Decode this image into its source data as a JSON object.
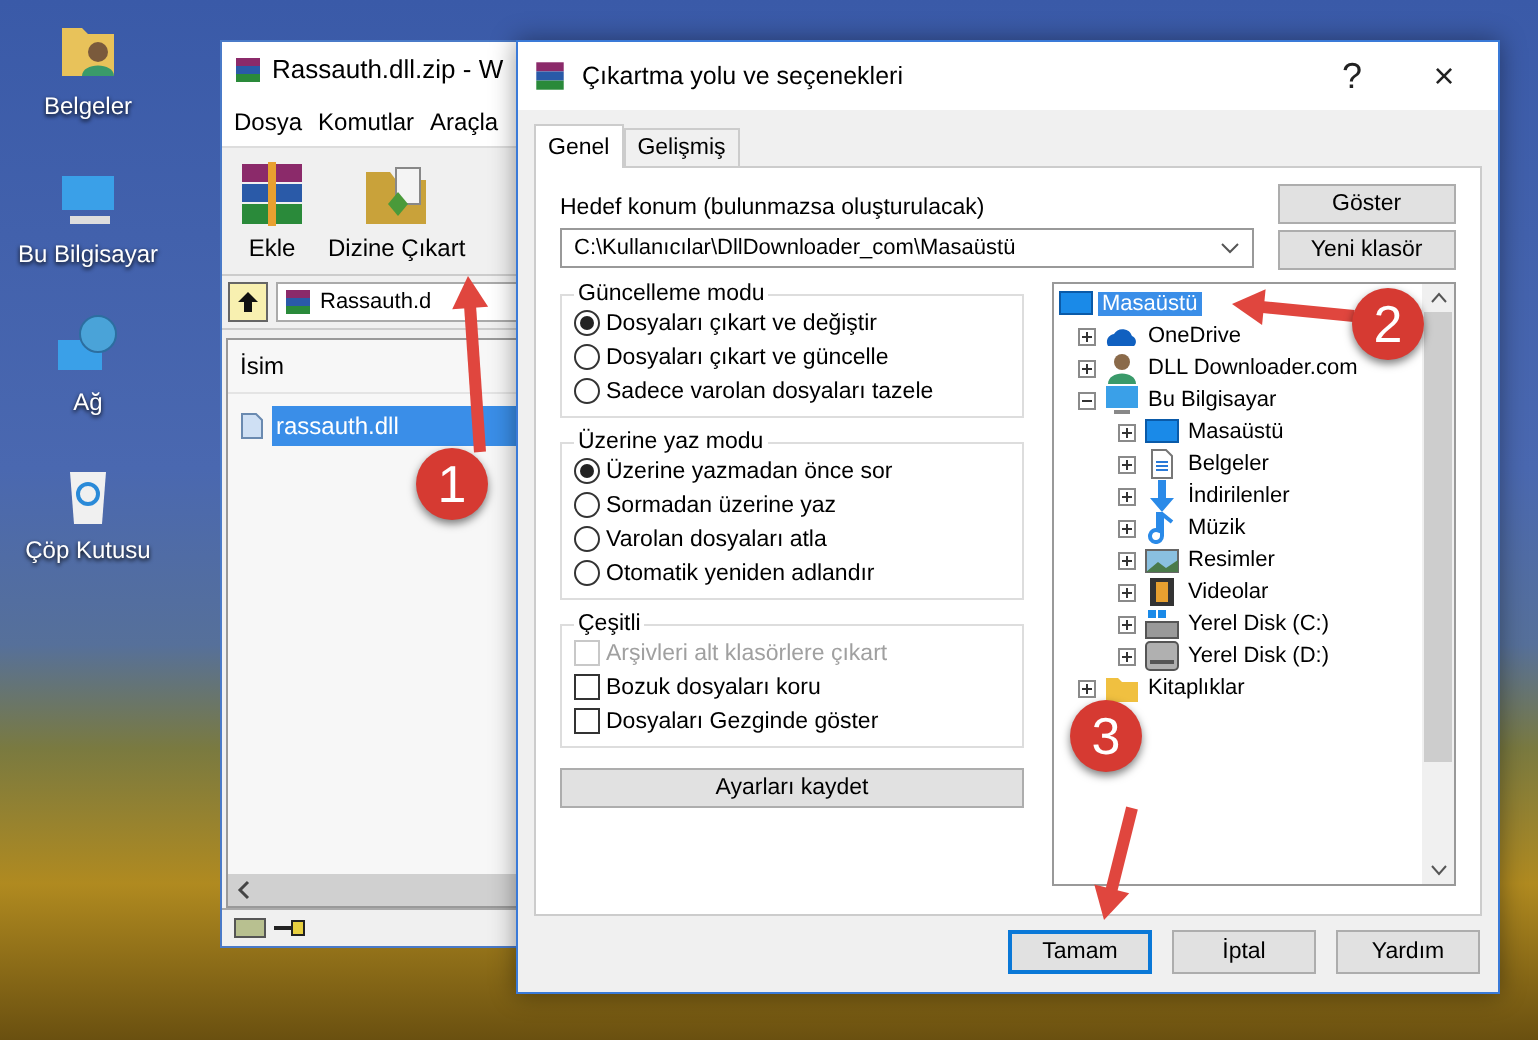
{
  "desktop_icons": [
    {
      "label": "Belgeler"
    },
    {
      "label": "Bu Bilgisayar"
    },
    {
      "label": "Ağ"
    },
    {
      "label": "Çöp Kutusu"
    }
  ],
  "archive_window": {
    "title": "Rassauth.dll.zip - W",
    "menu": [
      "Dosya",
      "Komutlar",
      "Araçla"
    ],
    "toolbar": [
      "Ekle",
      "Dizine Çıkart"
    ],
    "address": "Rassauth.d",
    "column": "İsim",
    "files": [
      {
        "name": "rassauth.dll",
        "selected": true
      }
    ]
  },
  "dialog": {
    "title": "Çıkartma yolu ve seçenekleri",
    "title_buttons": [
      "?",
      "×"
    ],
    "tabs": [
      {
        "label": "Genel",
        "selected": true
      },
      {
        "label": "Gelişmiş",
        "selected": false
      }
    ],
    "destination_label": "Hedef konum (bulunmazsa oluşturulacak)",
    "destination": "C:\\Kullanıcılar\\DllDownloader_com\\Masaüstü",
    "side_buttons": [
      "Göster",
      "Yeni klasör"
    ],
    "groups": [
      {
        "title": "Güncelleme modu",
        "kind": "radio",
        "options": [
          {
            "label": "Dosyaları çıkart ve değiştir",
            "selected": true,
            "disabled": false
          },
          {
            "label": "Dosyaları çıkart ve güncelle",
            "selected": false,
            "disabled": false
          },
          {
            "label": "Sadece varolan dosyaları tazele",
            "selected": false,
            "disabled": false
          }
        ]
      },
      {
        "title": "Üzerine yaz modu",
        "kind": "radio",
        "options": [
          {
            "label": "Üzerine yazmadan önce sor",
            "selected": true,
            "disabled": false
          },
          {
            "label": "Sormadan üzerine yaz",
            "selected": false,
            "disabled": false
          },
          {
            "label": "Varolan dosyaları atla",
            "selected": false,
            "disabled": false
          },
          {
            "label": "Otomatik yeniden adlandır",
            "selected": false,
            "disabled": false
          }
        ]
      },
      {
        "title": "Çeşitli",
        "kind": "check",
        "options": [
          {
            "label": "Arşivleri alt klasörlere çıkart",
            "checked": false,
            "disabled": true
          },
          {
            "label": "Bozuk dosyaları koru",
            "checked": false,
            "disabled": false
          },
          {
            "label": "Dosyaları Gezginde göster",
            "checked": false,
            "disabled": false
          }
        ]
      }
    ],
    "save_button": "Ayarları kaydet",
    "tree": [
      {
        "label": "Masaüstü",
        "selected": true,
        "children": [
          {
            "label": "OneDrive",
            "selected": false,
            "expanded": false
          },
          {
            "label": "DLL Downloader.com",
            "selected": false,
            "expanded": false
          },
          {
            "label": "Bu Bilgisayar",
            "selected": false,
            "expanded": true,
            "children": [
              {
                "label": "Masaüstü",
                "selected": false,
                "expanded": false
              },
              {
                "label": "Belgeler",
                "selected": false,
                "expanded": false
              },
              {
                "label": "İndirilenler",
                "selected": false,
                "expanded": false
              },
              {
                "label": "Müzik",
                "selected": false,
                "expanded": false
              },
              {
                "label": "Resimler",
                "selected": false,
                "expanded": false
              },
              {
                "label": "Videolar",
                "selected": false,
                "expanded": false
              },
              {
                "label": "Yerel Disk (C:)",
                "selected": false,
                "expanded": false
              },
              {
                "label": "Yerel Disk (D:)",
                "selected": false,
                "expanded": false
              }
            ]
          },
          {
            "label": "Kitaplıklar",
            "selected": false,
            "expanded": false
          }
        ]
      }
    ],
    "buttons": [
      {
        "label": "Tamam",
        "focused": true
      },
      {
        "label": "İptal",
        "focused": false
      },
      {
        "label": "Yardım",
        "focused": false
      }
    ]
  },
  "steps": [
    "1",
    "2",
    "3"
  ]
}
